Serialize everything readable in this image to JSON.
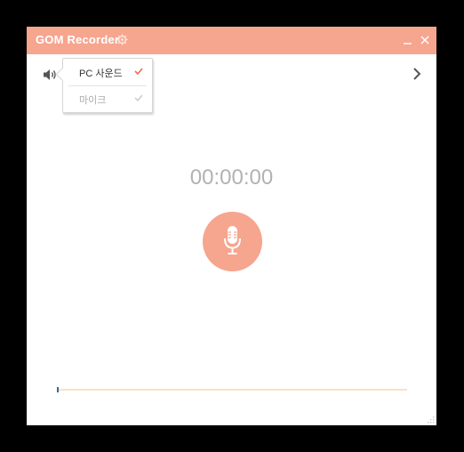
{
  "app": {
    "title": "GOM Recorder"
  },
  "audio_source_menu": {
    "items": [
      {
        "label": "PC 사운드",
        "checked": true,
        "check_color": "#f26b4c"
      },
      {
        "label": "마이크",
        "checked": false,
        "check_color": "#c8c8c8"
      }
    ]
  },
  "recorder": {
    "elapsed_time": "00:00:00",
    "level": 0
  },
  "colors": {
    "accent": "#f6a58f",
    "level_track": "#f7e4c6",
    "level_marker": "#3a66a8",
    "timer_text": "#b2b2b2"
  },
  "icons": {
    "title_settings": "gear-icon",
    "volume": "speaker-icon",
    "next": "chevron-right-icon",
    "record": "microphone-icon",
    "minimize": "minimize-icon",
    "close": "close-icon"
  }
}
